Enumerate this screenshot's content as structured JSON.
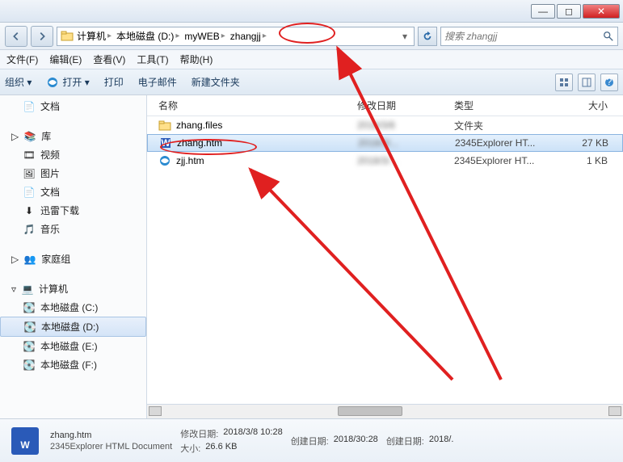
{
  "window": {
    "min": "—",
    "max": "◻",
    "close": "✕"
  },
  "breadcrumb": {
    "items": [
      "计算机",
      "本地磁盘 (D:)",
      "myWEB",
      "zhangjj"
    ]
  },
  "search": {
    "placeholder": "搜索 zhangjj"
  },
  "menubar": [
    "文件(F)",
    "编辑(E)",
    "查看(V)",
    "工具(T)",
    "帮助(H)"
  ],
  "toolbar": {
    "organize": "组织 ▾",
    "open": "打开 ▾",
    "print": "打印",
    "email": "电子邮件",
    "newfolder": "新建文件夹"
  },
  "sidebar": {
    "docs": "文档",
    "libhead": "库",
    "lib": [
      "视频",
      "图片",
      "文档",
      "迅雷下载",
      "音乐"
    ],
    "homegroup": "家庭组",
    "computerhead": "计算机",
    "drives": [
      "本地磁盘 (C:)",
      "本地磁盘 (D:)",
      "本地磁盘 (E:)",
      "本地磁盘 (F:)"
    ],
    "selected_drive_index": 1
  },
  "columns": {
    "name": "名称",
    "date": "修改日期",
    "type": "类型",
    "size": "大小"
  },
  "files": [
    {
      "name": "zhang.files",
      "date": "2018/3/8",
      "type": "文件夹",
      "size": "",
      "kind": "folder"
    },
    {
      "name": "zhang.htm",
      "date": "2018/3/...",
      "type": "2345Explorer HT...",
      "size": "27 KB",
      "kind": "htm",
      "selected": true
    },
    {
      "name": "zjj.htm",
      "date": "2018/3/...",
      "type": "2345Explorer HT...",
      "size": "1 KB",
      "kind": "htm"
    }
  ],
  "details": {
    "filename": "zhang.htm",
    "filetype": "2345Explorer HTML Document",
    "mod_label": "修改日期:",
    "mod_value": "2018/3/8 10:28",
    "size_label": "大小:",
    "size_value": "26.6 KB",
    "created_label": "创建日期:",
    "created_value": "2018/30:28",
    "created2_label": "创建日期:",
    "created2_value": "2018/."
  },
  "colors": {
    "accent": "#e02020",
    "selection": "#cce2f8"
  }
}
